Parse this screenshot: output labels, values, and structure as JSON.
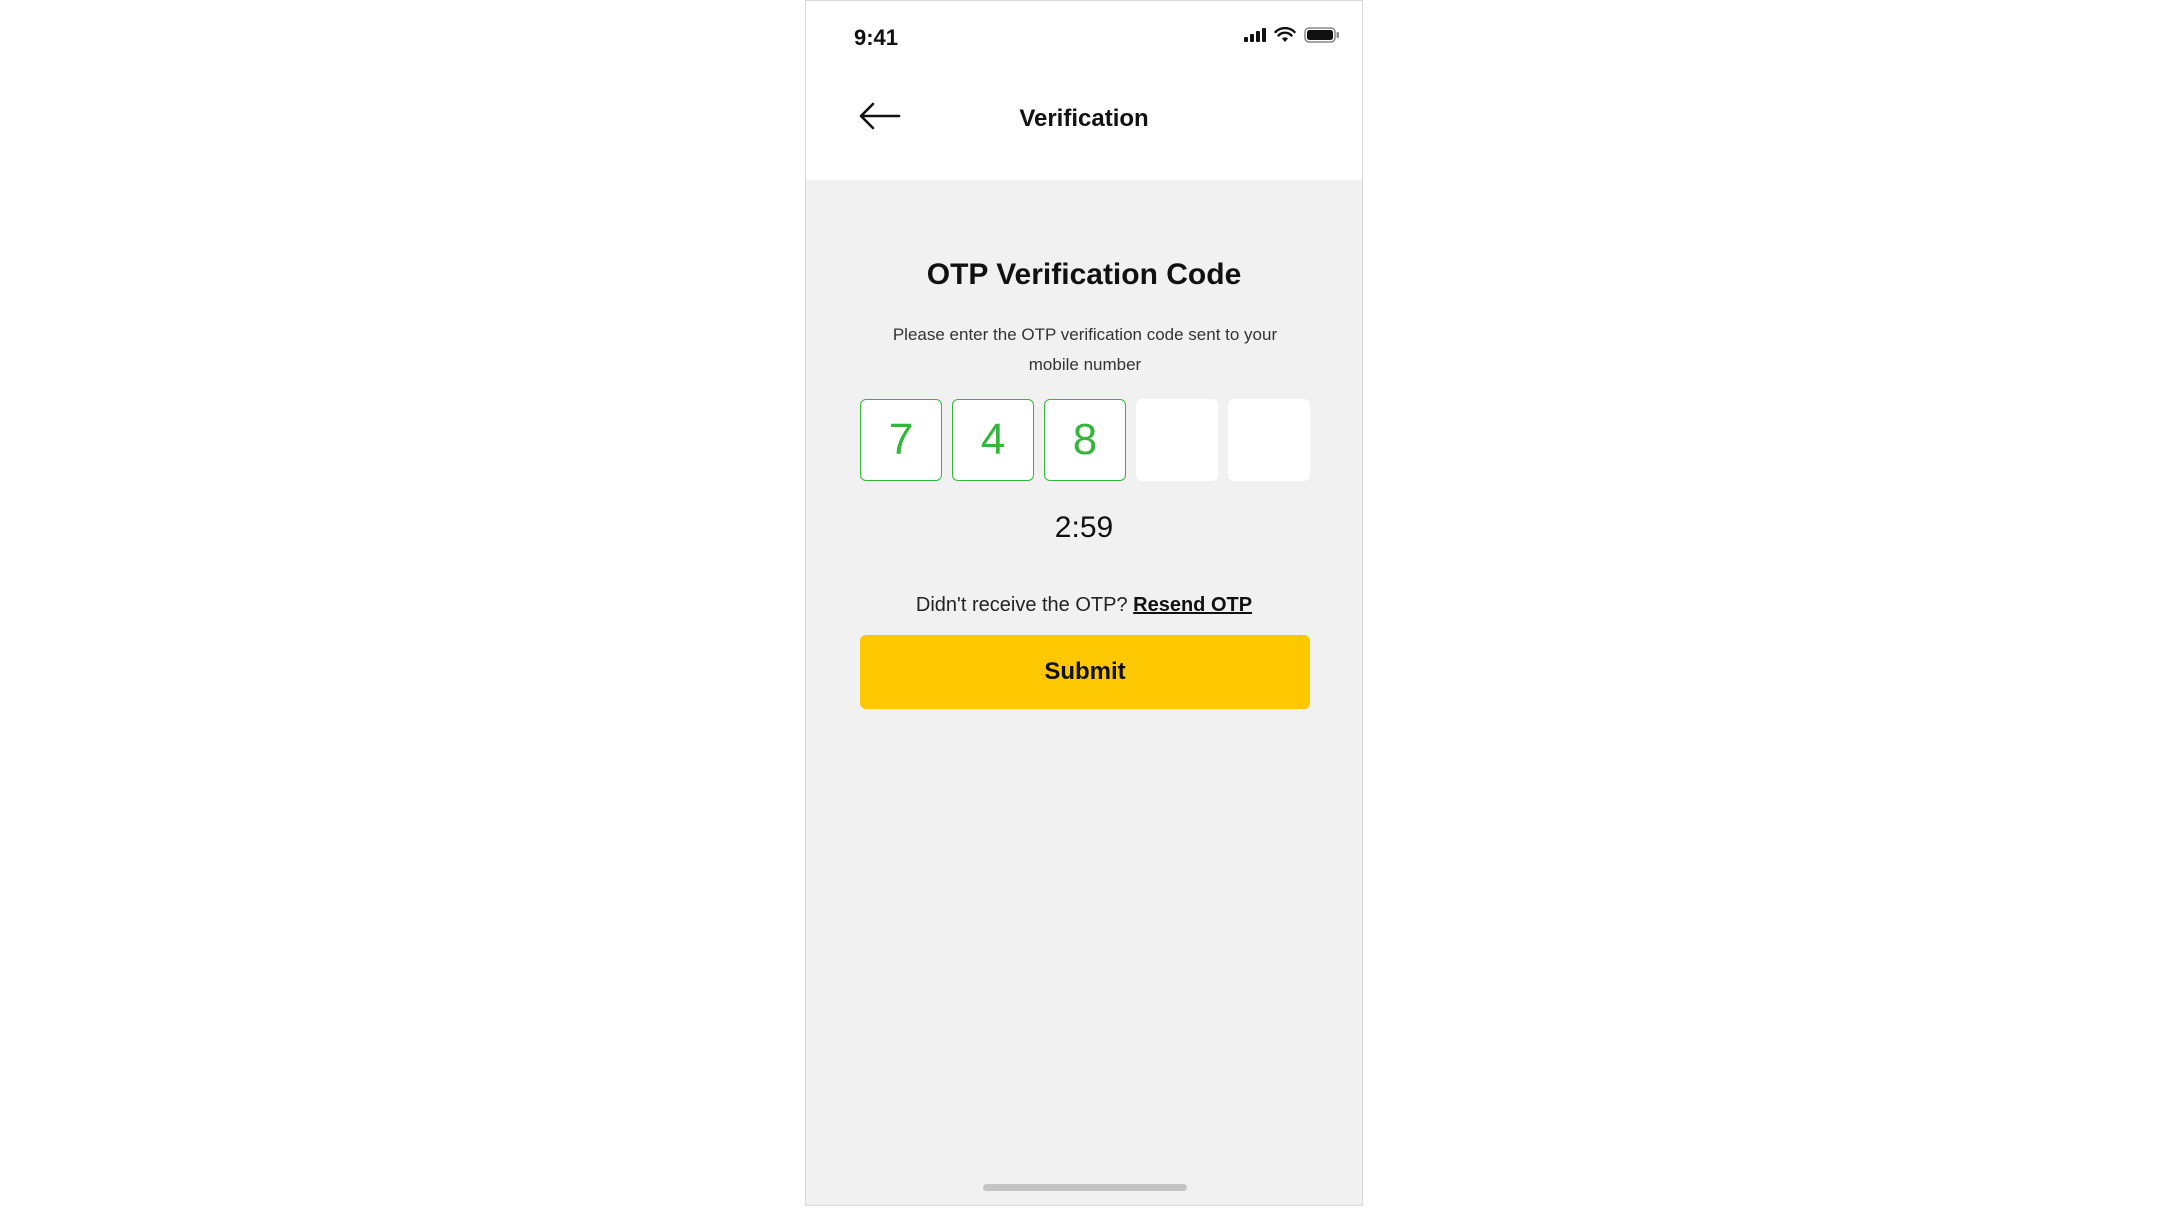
{
  "status_bar": {
    "time": "9:41",
    "icons": [
      "signal-icon",
      "wifi-icon",
      "battery-icon"
    ]
  },
  "header": {
    "back_icon": "arrow-left-icon",
    "title": "Verification"
  },
  "otp": {
    "title": "OTP Verification Code",
    "description": "Please enter the OTP verification code sent to your mobile number",
    "digits": [
      "7",
      "4",
      "8",
      "",
      ""
    ],
    "timer": "2:59"
  },
  "resend": {
    "prompt": "Didn't receive the OTP?",
    "link_label": "Resend OTP"
  },
  "submit": {
    "label": "Submit"
  },
  "colors": {
    "accent_yellow": "#fdc800",
    "success_green": "#35b53b",
    "background_gray": "#f1f1f1"
  }
}
